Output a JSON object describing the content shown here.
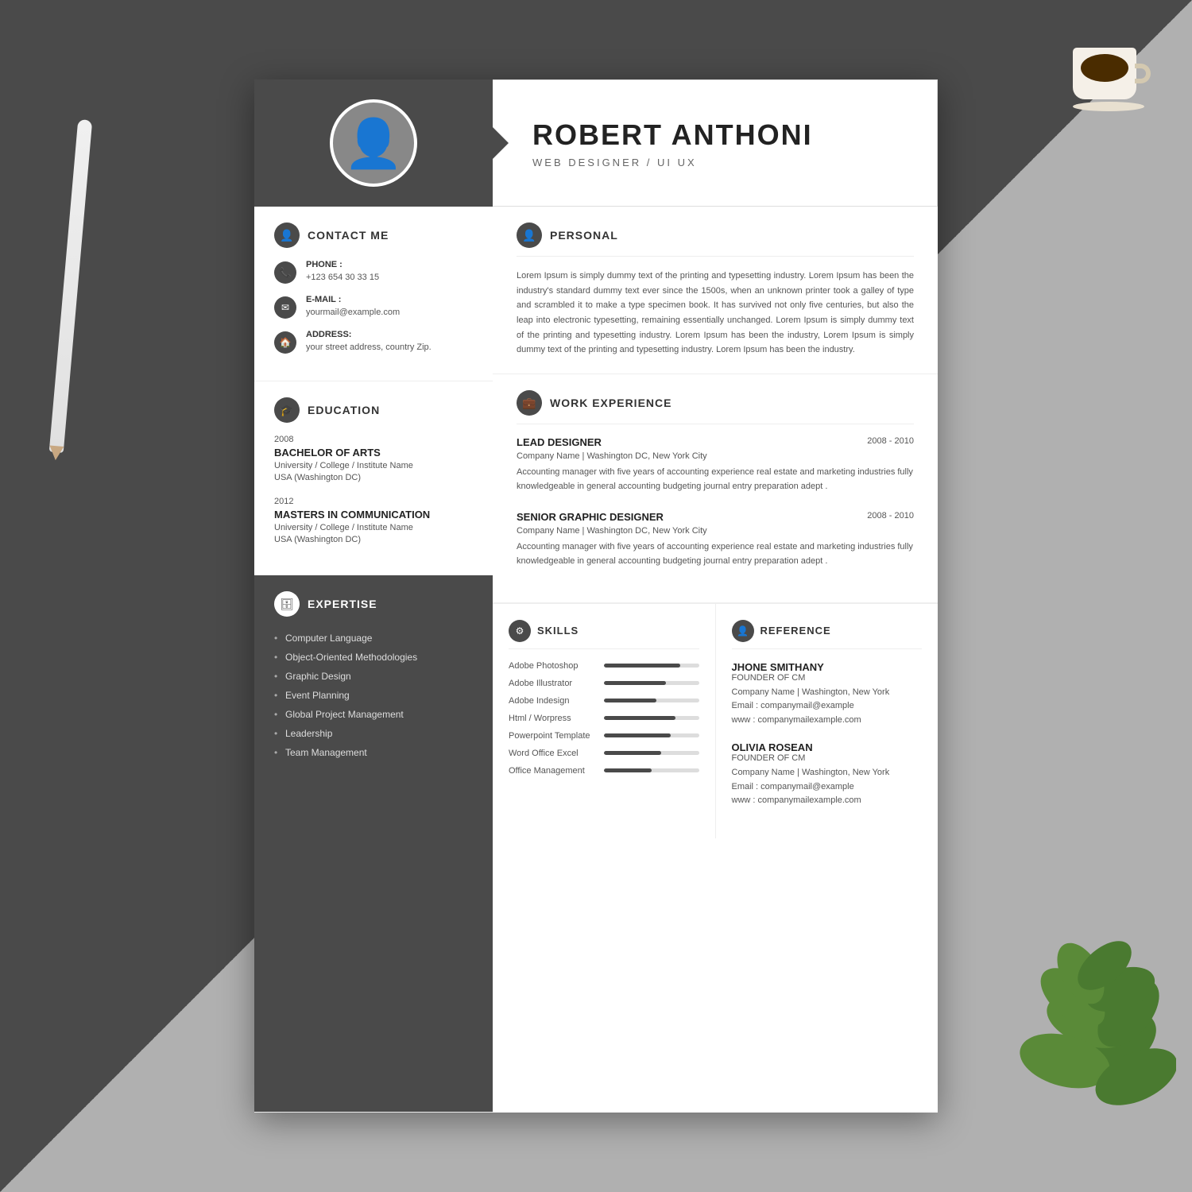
{
  "header": {
    "name": "ROBERT ANTHONI",
    "title": "WEB DESIGNER / UI UX"
  },
  "contact": {
    "section_title": "CONTACT ME",
    "phone_label": "PHONE :",
    "phone_value": "+123 654 30 33 15",
    "email_label": "E-MAIL :",
    "email_value": "yourmail@example.com",
    "address_label": "ADDRESS:",
    "address_value": "your street address, country Zip."
  },
  "education": {
    "section_title": "EDUCATION",
    "items": [
      {
        "year": "2008",
        "degree": "BACHELOR OF ARTS",
        "school": "University / College / Institute Name",
        "location": "USA (Washington DC)"
      },
      {
        "year": "2012",
        "degree": "MASTERS IN COMMUNICATION",
        "school": "University / College / Institute Name",
        "location": "USA (Washington DC)"
      }
    ]
  },
  "expertise": {
    "section_title": "EXPERTISE",
    "items": [
      "Computer Language",
      "Object-Oriented Methodologies",
      "Graphic Design",
      "Event Planning",
      "Global Project Management",
      "Leadership",
      "Team Management"
    ]
  },
  "personal": {
    "section_title": "PERSONAL",
    "text": "Lorem Ipsum is simply dummy text of the printing and typesetting industry. Lorem Ipsum has been the industry's standard dummy text ever since the 1500s, when an unknown printer took a galley of type and scrambled it to make a type specimen book. It has survived not only five centuries, but also the leap into electronic typesetting, remaining essentially unchanged. Lorem Ipsum is simply dummy text of the printing and typesetting industry. Lorem Ipsum has been the industry, Lorem Ipsum is simply dummy text of the printing and typesetting industry. Lorem Ipsum has been the industry."
  },
  "work_experience": {
    "section_title": "WORK EXPERIENCE",
    "items": [
      {
        "title": "LEAD DESIGNER",
        "company": "Company Name  |  Washington DC, New York City",
        "dates": "2008 - 2010",
        "description": "Accounting manager with five years of accounting experience real estate and marketing industries fully knowledgeable in general accounting budgeting journal entry preparation adept ."
      },
      {
        "title": "SENIOR GRAPHIC DESIGNER",
        "company": "Company Name  |  Washington DC, New York City",
        "dates": "2008 - 2010",
        "description": "Accounting manager with five years of accounting experience real estate and marketing industries fully knowledgeable in general accounting budgeting journal entry preparation adept ."
      }
    ]
  },
  "skills": {
    "section_title": "SKILLS",
    "items": [
      {
        "label": "Adobe Photoshop",
        "percent": 80
      },
      {
        "label": "Adobe Illustrator",
        "percent": 65
      },
      {
        "label": "Adobe Indesign",
        "percent": 55
      },
      {
        "label": "Html / Worpress",
        "percent": 75
      },
      {
        "label": "Powerpoint Template",
        "percent": 70
      },
      {
        "label": "Word Office Excel",
        "percent": 60
      },
      {
        "label": "Office Management",
        "percent": 50
      }
    ]
  },
  "reference": {
    "section_title": "REFERENCE",
    "items": [
      {
        "name": "JHONE SMITHANY",
        "role": "FOUNDER OF CM",
        "company": "Company Name  |  Washington, New York",
        "email": "Email : companymail@example",
        "website": "www : companymailexample.com"
      },
      {
        "name": "OLIVIA ROSEAN",
        "role": "FOUNDER OF CM",
        "company": "Company Name  |  Washington, New York",
        "email": "Email : companymail@example",
        "website": "www : companymailexample.com"
      }
    ]
  }
}
